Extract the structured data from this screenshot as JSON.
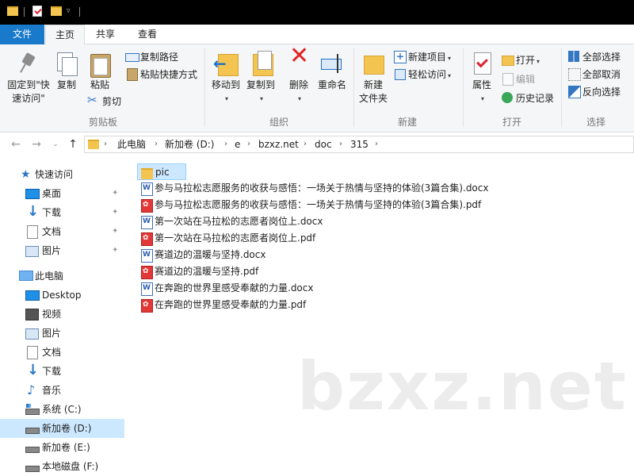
{
  "ribbon_tabs": {
    "file": "文件",
    "home": "主页",
    "share": "共享",
    "view": "查看"
  },
  "clipboard": {
    "pin": "固定到\"快\n速访问\"",
    "copy": "复制",
    "paste": "粘贴",
    "copy_path": "复制路径",
    "paste_shortcut": "粘贴快捷方式",
    "cut": "剪切",
    "label": "剪贴板"
  },
  "organize": {
    "move_to": "移动到",
    "copy_to": "复制到",
    "delete": "删除",
    "rename": "重命名",
    "label": "组织"
  },
  "new_group": {
    "new_folder": "新建\n文件夹",
    "new_item": "新建项目",
    "easy_access": "轻松访问",
    "label": "新建"
  },
  "open_group": {
    "properties": "属性",
    "open": "打开",
    "edit": "编辑",
    "history": "历史记录",
    "label": "打开"
  },
  "select_group": {
    "select_all": "全部选择",
    "select_none": "全部取消",
    "invert": "反向选择",
    "label": "选择"
  },
  "breadcrumb": [
    "此电脑",
    "新加卷 (D:)",
    "e",
    "bzxz.net",
    "doc",
    "315"
  ],
  "nav": {
    "quick_access": "快速访问",
    "desktop": "桌面",
    "downloads": "下载",
    "documents": "文档",
    "pictures": "图片",
    "this_pc": "此电脑",
    "pc_desktop": "Desktop",
    "videos": "视频",
    "pc_pictures": "图片",
    "pc_documents": "文档",
    "pc_downloads": "下载",
    "music": "音乐",
    "drive_c": "系统 (C:)",
    "drive_d": "新加卷 (D:)",
    "drive_e": "新加卷 (E:)",
    "drive_f": "本地磁盘 (F:)"
  },
  "files": [
    {
      "name": "pic",
      "type": "folder"
    },
    {
      "name": "参与马拉松志愿服务的收获与感悟：一场关于热情与坚持的体验(3篇合集).docx",
      "type": "word"
    },
    {
      "name": "参与马拉松志愿服务的收获与感悟：一场关于热情与坚持的体验(3篇合集).pdf",
      "type": "pdf"
    },
    {
      "name": "第一次站在马拉松的志愿者岗位上.docx",
      "type": "word"
    },
    {
      "name": "第一次站在马拉松的志愿者岗位上.pdf",
      "type": "pdf"
    },
    {
      "name": "赛道边的温暖与坚持.docx",
      "type": "word"
    },
    {
      "name": "赛道边的温暖与坚持.pdf",
      "type": "pdf"
    },
    {
      "name": "在奔跑的世界里感受奉献的力量.docx",
      "type": "word"
    },
    {
      "name": "在奔跑的世界里感受奉献的力量.pdf",
      "type": "pdf"
    }
  ],
  "watermark": "bzxz.net",
  "colors": {
    "accent": "#1979ca",
    "selection": "#cce8ff",
    "folder": "#f3c44f"
  }
}
